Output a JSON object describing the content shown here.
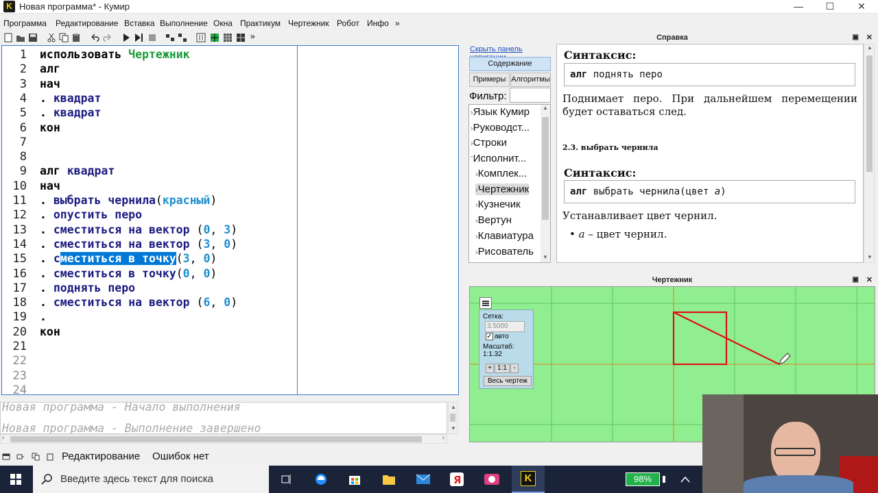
{
  "window": {
    "title": "Новая программа* - Кумир",
    "app_icon": "K"
  },
  "menu": {
    "items": [
      "Программа",
      "Редактирование",
      "Вставка",
      "Выполнение",
      "Окна",
      "Практикум",
      "Чертежник",
      "Робот",
      "Инфо",
      "»"
    ]
  },
  "toolbar": {
    "overflow": "»"
  },
  "editor": {
    "line_numbers": [
      "1",
      "2",
      "3",
      "4",
      "5",
      "6",
      "7",
      "8",
      "9",
      "10",
      "11",
      "12",
      "13",
      "14",
      "15",
      "16",
      "17",
      "18",
      "19",
      "20",
      "21",
      "22",
      "23",
      "24"
    ],
    "lines": [
      {
        "kw": "использовать",
        "rest": " ",
        "ex": "Чертежник"
      },
      {
        "kw": "алг"
      },
      {
        "kw": "нач"
      },
      {
        "dot": ". ",
        "nm": "квадрат"
      },
      {
        "dot": ". ",
        "nm": "квадрат"
      },
      {
        "kw": "кон"
      },
      {},
      {},
      {
        "kw": "алг",
        "rest": " ",
        "nm": "квадрат"
      },
      {
        "kw": "нач"
      },
      {
        "dot": ". ",
        "nm": "выбрать чернила",
        "p1": "(",
        "c1": "красный",
        "p2": ")"
      },
      {
        "dot": ". ",
        "nm": "опустить перо"
      },
      {
        "dot": ". ",
        "nm": "сместиться на вектор",
        "p1": " (",
        "c1": "0",
        ",": ", ",
        "c2": "3",
        "p2": ")"
      },
      {
        "dot": ". ",
        "nm": "сместиться на вектор",
        "p1": " (",
        "c1": "3",
        ",": ", ",
        "c2": "0",
        "p2": ")"
      },
      {
        "dot": ". ",
        "nm": "сместиться в точку",
        "p1": "(",
        "c1": "3",
        ",": ", ",
        "c2": "0",
        "p2": ")"
      },
      {
        "dot": ". ",
        "nm": "сместиться в точку",
        "p1": "(",
        "c1": "0",
        ",": ", ",
        "c2": "0",
        "p2": ")"
      },
      {
        "dot": ". ",
        "nm": "поднять перо"
      },
      {
        "dot": ". ",
        "nm": "сместиться на вектор",
        "p1": " (",
        "c1": "6",
        ",": ", ",
        "c2": "0",
        "p2": ")"
      },
      {
        "dot": "."
      },
      {
        "kw": "кон"
      }
    ]
  },
  "console": {
    "lines": [
      "Новая программа - Начало выполнения",
      "Новая программа - Выполнение завершено"
    ]
  },
  "status": {
    "mode": "Редактирование",
    "errors": "Ошибок нет"
  },
  "help": {
    "title": "Справка",
    "hide_nav": "Скрыть панель навигации",
    "contents_btn": "Содержание",
    "examples_btn": "Примеры",
    "algorithms_btn": "Алгоритмы",
    "filter_label": "Фильтр:",
    "nav_items": [
      "Язык Кумир",
      "Руководст...",
      "Строки",
      "Исполнит...",
      "Комплек...",
      "Чертежник",
      "Кузнечик",
      "Вертун",
      "Клавиатура",
      "Рисователь"
    ],
    "syntax_label_1": "Синтаксис:",
    "syntax_1_kw": "алг",
    "syntax_1_rest": " поднять перо",
    "desc_1": "Поднимает перо. При дальнейшем перемещении будет оставаться след.",
    "section_2": "2.3. выбрать чернила",
    "syntax_label_2": "Синтаксис:",
    "syntax_2_kw": "алг",
    "syntax_2_rest": " выбрать чернила(цвет ",
    "syntax_2_arg": "a",
    "syntax_2_close": ")",
    "desc_2": "Устанавливает цвет чернил.",
    "bullet_arg": "a",
    "bullet_text": " – цвет чернил."
  },
  "draftsman": {
    "title": "Чертежник",
    "grid_label": "Сетка:",
    "grid_value": "3.5000",
    "auto_label": "авто",
    "scale_label": "Масштаб:",
    "scale_value": "1:1.32",
    "zoom_in": "+",
    "zoom_one": "1:1",
    "zoom_out": "-",
    "fit_btn": "Весь чертеж",
    "colors": {
      "background": "#90ee90",
      "grid": "#5cc85c",
      "axis": "#e08020",
      "ink": "#e01010"
    }
  },
  "taskbar": {
    "search_placeholder": "Введите здесь текст для поиска",
    "battery": "98%"
  }
}
